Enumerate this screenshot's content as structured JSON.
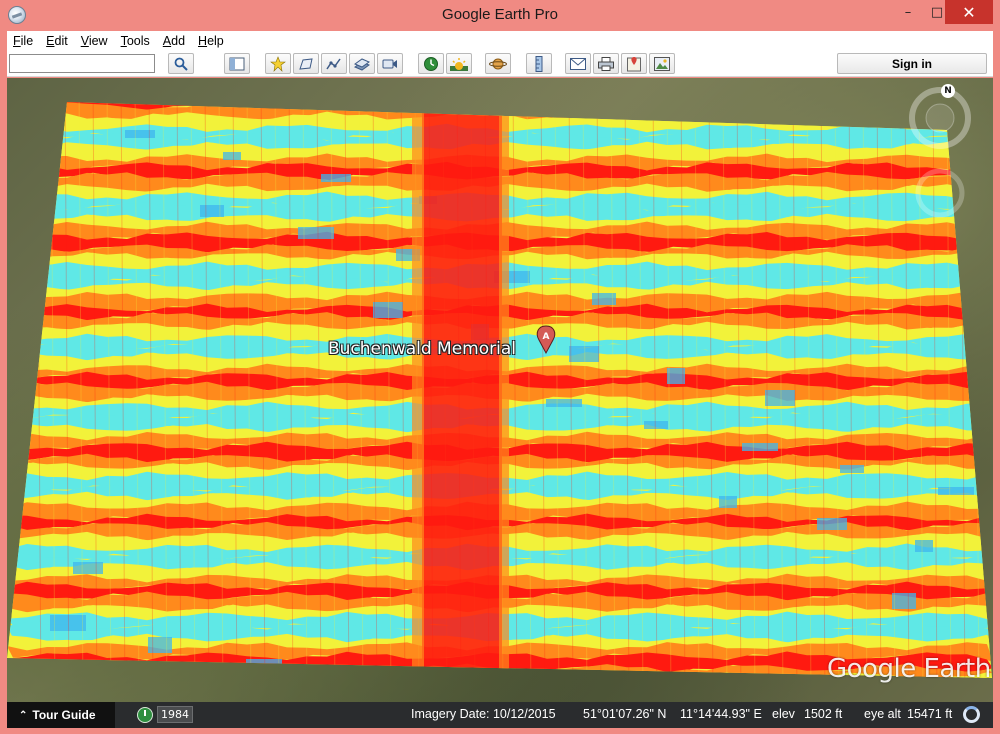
{
  "window": {
    "title": "Google Earth Pro"
  },
  "menu": {
    "items": [
      "File",
      "Edit",
      "View",
      "Tools",
      "Add",
      "Help"
    ]
  },
  "toolbar": {
    "search_value": "",
    "signin_label": "Sign in",
    "buttons": [
      {
        "name": "search-button",
        "icon": "search-icon"
      },
      {
        "name": "sidebar-toggle-button",
        "icon": "sidebar-icon"
      },
      {
        "name": "add-placemark-button",
        "icon": "placemark-icon"
      },
      {
        "name": "add-polygon-button",
        "icon": "polygon-icon"
      },
      {
        "name": "add-path-button",
        "icon": "path-icon"
      },
      {
        "name": "add-overlay-button",
        "icon": "image-overlay-icon"
      },
      {
        "name": "record-tour-button",
        "icon": "record-tour-icon"
      },
      {
        "name": "historical-imagery-button",
        "icon": "clock-icon"
      },
      {
        "name": "sunlight-button",
        "icon": "sun-icon"
      },
      {
        "name": "planets-button",
        "icon": "planet-icon"
      },
      {
        "name": "ruler-button",
        "icon": "ruler-icon"
      },
      {
        "name": "email-button",
        "icon": "email-icon"
      },
      {
        "name": "print-button",
        "icon": "print-icon"
      },
      {
        "name": "view-in-maps-button",
        "icon": "maps-icon"
      },
      {
        "name": "save-image-button",
        "icon": "save-image-icon"
      }
    ]
  },
  "map": {
    "placemark_label": "Buchenwald Memorial",
    "placemark_marker": "A",
    "compass_label": "N",
    "watermark": "Google Earth"
  },
  "statusbar": {
    "tour_guide": "Tour Guide",
    "year": "1984",
    "imagery_date": "Imagery Date: 10/12/2015",
    "latitude": "51°01'07.26\" N",
    "longitude": "11°14'44.93\" E",
    "elev_label": "elev",
    "elev_value": "1502 ft",
    "eye_alt_label": "eye alt",
    "eye_alt_value": "15471 ft"
  },
  "colors": {
    "title_bar": "#f08a83",
    "close_button": "#c7332c",
    "status_bar": "#2a2c2e",
    "heat_red": "#ff1a10",
    "heat_orange": "#ff8a1c",
    "heat_yellow": "#f2f23a",
    "heat_cyan": "#5fe8e6",
    "heat_blue": "#3fb6ee"
  }
}
